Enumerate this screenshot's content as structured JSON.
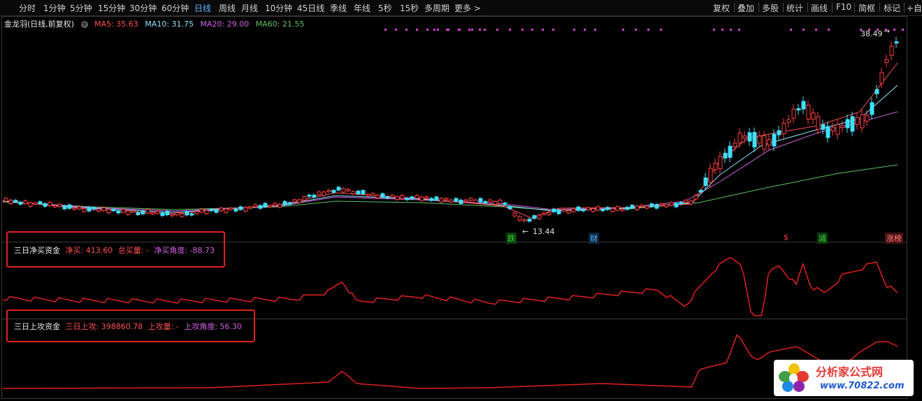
{
  "toolbar": {
    "periods": [
      "分时",
      "1分钟",
      "5分钟",
      "15分钟",
      "30分钟",
      "60分钟",
      "日线",
      "周线",
      "月线",
      "10分钟",
      "45日线",
      "季线",
      "年线",
      "5秒",
      "15秒",
      "多周期",
      "更多 >"
    ],
    "active_period": "日线",
    "tools": [
      "复权",
      "叠加",
      "多股",
      "统计",
      "画线",
      "F10",
      "简框",
      "标记",
      "+自"
    ]
  },
  "header": {
    "stock": "金龙羽(日线,前复权)",
    "ma5": "MA5: 35.63",
    "ma10": "MA10: 31.75",
    "ma20": "MA20: 29.00",
    "ma60": "MA60: 21.55"
  },
  "price_labels": {
    "high": "38.49",
    "low": "13.44"
  },
  "markers": [
    {
      "text": "跌",
      "color": "#3bd13b"
    },
    {
      "text": "财",
      "color": "#5ab0ff"
    },
    {
      "text": "$",
      "color": "#ff4040"
    },
    {
      "text": "减",
      "color": "#3bd13b"
    },
    {
      "text": "涨榜",
      "color": "#ff8080"
    }
  ],
  "indicator1": {
    "name": "三日净买资金",
    "v1_label": "净买: 413.60",
    "v2_label": "总买量: -",
    "v3_label": "净买角度: -88.73"
  },
  "indicator2": {
    "name": "三日上攻资金",
    "v1_label": "三日上攻: 398860.78",
    "v2_label": "上攻量: -",
    "v3_label": "上攻角度: 56.30"
  },
  "watermark": {
    "title": "分析家公式网",
    "url": "www.70822.com"
  },
  "colors": {
    "up": "#ff4040",
    "down": "#40e0ff",
    "ma5": "#ff5050",
    "ma10": "#8fe0ff",
    "ma20": "#d060e0",
    "ma60": "#60c060",
    "indicator": "#e02020",
    "active": "#5ab0ff"
  },
  "icons": {
    "settings": "gear-icon",
    "arrow": "arrow-icon"
  }
}
